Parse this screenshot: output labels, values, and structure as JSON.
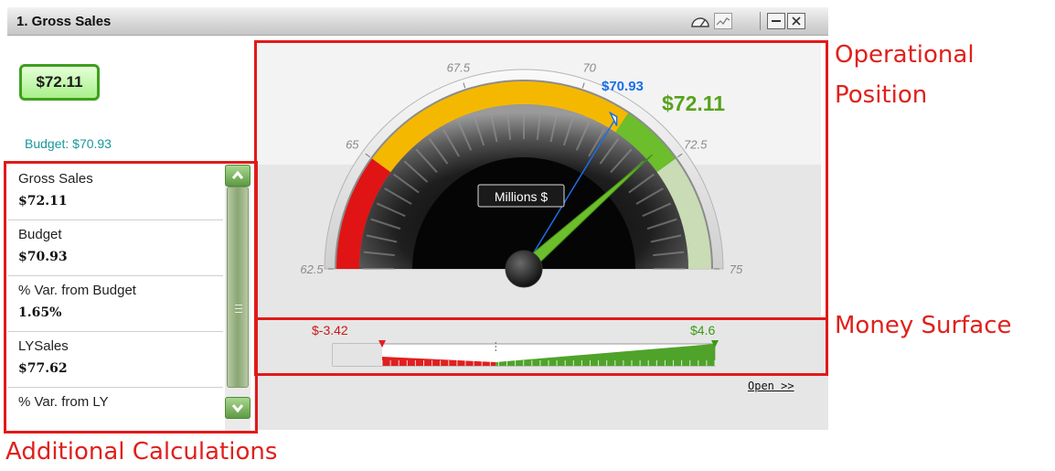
{
  "widget": {
    "title": "1. Gross Sales",
    "toolbar": {
      "gauge_icon": "gauge-icon",
      "chart_icon": "line-chart-icon",
      "minimize_icon": "minimize-icon",
      "close_icon": "close-icon"
    },
    "kpi": {
      "value": "$72.11",
      "budget_label": "Budget: $70.93"
    },
    "gauge": {
      "ticks": [
        "62.5",
        "65",
        "67.5",
        "70",
        "72.5",
        "75"
      ],
      "range": [
        62.5,
        75
      ],
      "unit_label": "Millions $",
      "value": 72.11,
      "value_label": "$72.11",
      "target": 70.93,
      "target_label": "$70.93",
      "bands": [
        {
          "from": 62.5,
          "to": 65,
          "color": "#e01414"
        },
        {
          "from": 65,
          "to": 71.1,
          "color": "#f5b800"
        },
        {
          "from": 71.1,
          "to": 72.5,
          "color": "#6cbe2c"
        },
        {
          "from": 72.5,
          "to": 75,
          "color": "#c9dcb5"
        }
      ]
    },
    "money": {
      "min_label": "$-3.42",
      "max_label": "$4.6",
      "min": -3.42,
      "max": 4.6
    },
    "calculations": [
      {
        "label": "Gross Sales",
        "value": "$72.11"
      },
      {
        "label": "Budget",
        "value": "$70.93"
      },
      {
        "label": "% Var. from Budget",
        "value": "1.65%"
      },
      {
        "label": "LYSales",
        "value": "$77.62"
      },
      {
        "label": "% Var. from LY",
        "value": ""
      }
    ],
    "open_link": "Open >>"
  },
  "annotations": {
    "operational_line1": "Operational",
    "operational_line2": "Position",
    "money_surface": "Money Surface",
    "additional_calculations": "Additional Calculations"
  },
  "colors": {
    "annotation": "#e0201c",
    "kpi_border": "#3f9f1f",
    "budget_text": "#17979b",
    "target_needle": "#1a6fe8",
    "value_needle": "#6cbe2c"
  }
}
